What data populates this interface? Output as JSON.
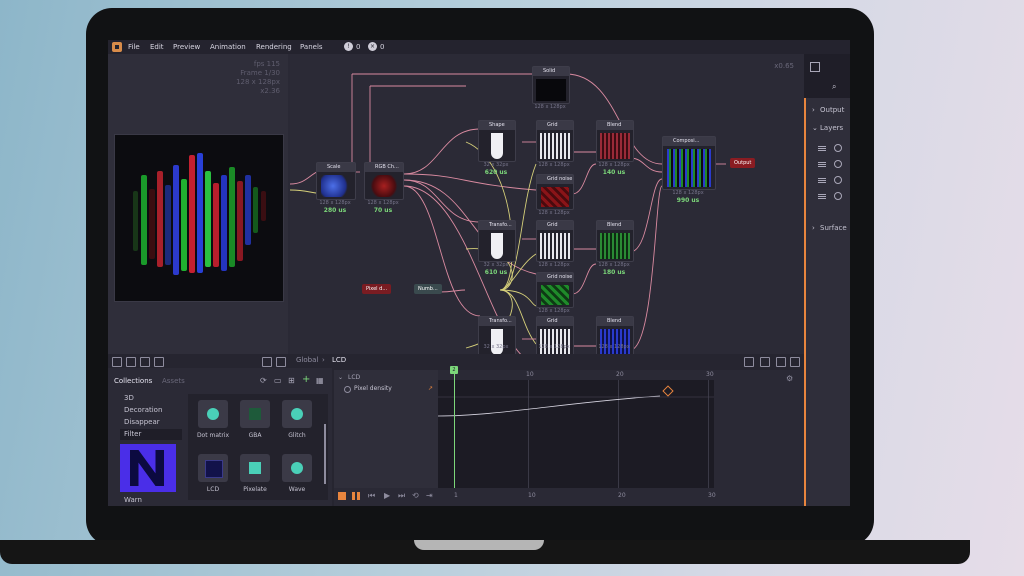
{
  "menu": {
    "items": [
      "File",
      "Edit",
      "Preview",
      "Animation",
      "Rendering",
      "Panels"
    ],
    "warnings": "0",
    "errors": "0"
  },
  "preview": {
    "fps": "fps 115",
    "frame": "Frame 1/30",
    "size": "128 x 128px",
    "zoom": "x2.36"
  },
  "graph": {
    "zoom": "x0.65",
    "nodes": {
      "scale": {
        "title": "Scale",
        "sub": "128 x 128px",
        "time": "280 us"
      },
      "rgb": {
        "title": "RGB Ch...",
        "sub": "128 x 128px",
        "time": "70 us"
      },
      "solid": {
        "title": "Solid",
        "sub": "128 x 128px"
      },
      "shape1": {
        "title": "Shape",
        "sub": "32 x 32px",
        "time": "620 us"
      },
      "grid1": {
        "title": "Grid",
        "sub": "128 x 128px"
      },
      "blend1": {
        "title": "Blend",
        "sub": "128 x 128px",
        "time": "140 us"
      },
      "gridnoise1": {
        "title": "Grid noise",
        "sub": "128 x 128px"
      },
      "transform1": {
        "title": "Transfo...",
        "sub": "32 x 32px",
        "time": "610 us"
      },
      "grid2": {
        "title": "Grid",
        "sub": "128 x 128px"
      },
      "blend2": {
        "title": "Blend",
        "sub": "128 x 128px",
        "time": "180 us"
      },
      "gridnoise2": {
        "title": "Grid noise",
        "sub": "128 x 128px"
      },
      "transform2": {
        "title": "Transfo...",
        "sub": "32 x 32px"
      },
      "grid3": {
        "title": "Grid",
        "sub": "128 x 128px"
      },
      "blend3": {
        "title": "Blend",
        "sub": "128 x 128px"
      },
      "composite": {
        "title": "Composi...",
        "sub": "128 x 128px",
        "time": "990 us"
      },
      "pixel": {
        "title": "Pixel d..."
      },
      "reroute": {
        "title": "Numb..."
      },
      "output": {
        "title": "Output"
      }
    }
  },
  "breadcrumb": {
    "root": "Global",
    "current": "LCD"
  },
  "right_panel": {
    "output": "Output",
    "layers": "Layers",
    "surface": "Surface"
  },
  "collections": {
    "tabs": [
      "Collections",
      "Assets"
    ],
    "categories": [
      "3D",
      "Decoration",
      "Disappear",
      "Filter",
      "Warn"
    ],
    "assets": [
      "Dot matrix",
      "GBA",
      "Glitch",
      "LCD",
      "Pixelate",
      "Wave"
    ]
  },
  "timeline": {
    "track": "LCD",
    "property": "Pixel density",
    "current_frame": "2",
    "ticks": [
      "10",
      "20",
      "30"
    ],
    "bottom_ticks": [
      "1",
      "10",
      "20",
      "30"
    ]
  },
  "colors": {
    "accent": "#e8853e",
    "time": "#7cd77a",
    "wire_pink": "#d98aa0",
    "wire_yellow": "#d6d07a"
  }
}
